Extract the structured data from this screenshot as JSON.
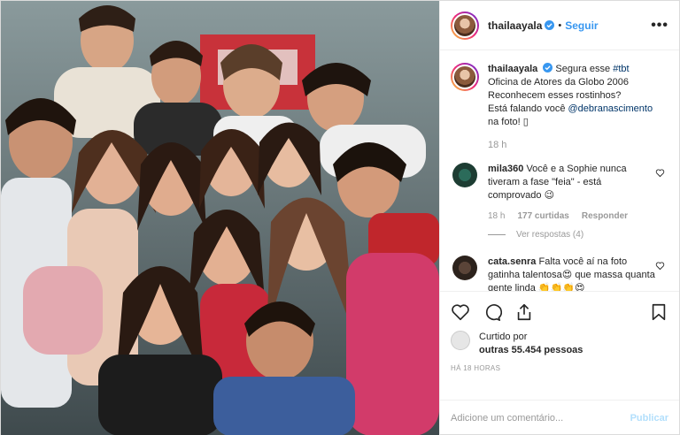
{
  "post": {
    "username": "thailaayala",
    "follow_label": "Seguir",
    "more_label": "•••",
    "dot": "•"
  },
  "caption": {
    "username": "thailaayala",
    "line1": "Segura esse",
    "hashtag": "#tbt",
    "line2": "Oficina de Atores da Globo 2006",
    "line3": "Reconhecem esses rostinhos?",
    "line4": "Está falando você",
    "mention": "@debranascimento",
    "line5": "na foto! ▯",
    "time": "18 h"
  },
  "comments": [
    {
      "username": "mila360",
      "text": "Você e a Sophie nunca tiveram a fase \"feia\" - está comprovado 😉",
      "time": "18 h",
      "likes": "177 curtidas",
      "reply_label": "Responder",
      "view_replies": "Ver respostas (4)"
    },
    {
      "username": "cata.senra",
      "text": "Falta você aí na foto gatinha talentosa😍 que massa quanta gente linda 👏👏👏😍"
    }
  ],
  "likes": {
    "prefix": "Curtido por",
    "suffix": "outras 55.454 pessoas"
  },
  "timestamp": "HÁ 18 HORAS",
  "add_comment": {
    "placeholder": "Adicione um comentário...",
    "publish_label": "Publicar"
  },
  "colors": {
    "accent": "#3897f0",
    "muted": "#999999",
    "text": "#262626",
    "publish_disabled": "#b2dffc"
  },
  "icons": [
    "heart-icon",
    "comment-icon",
    "share-icon",
    "bookmark-icon",
    "verified-icon"
  ]
}
